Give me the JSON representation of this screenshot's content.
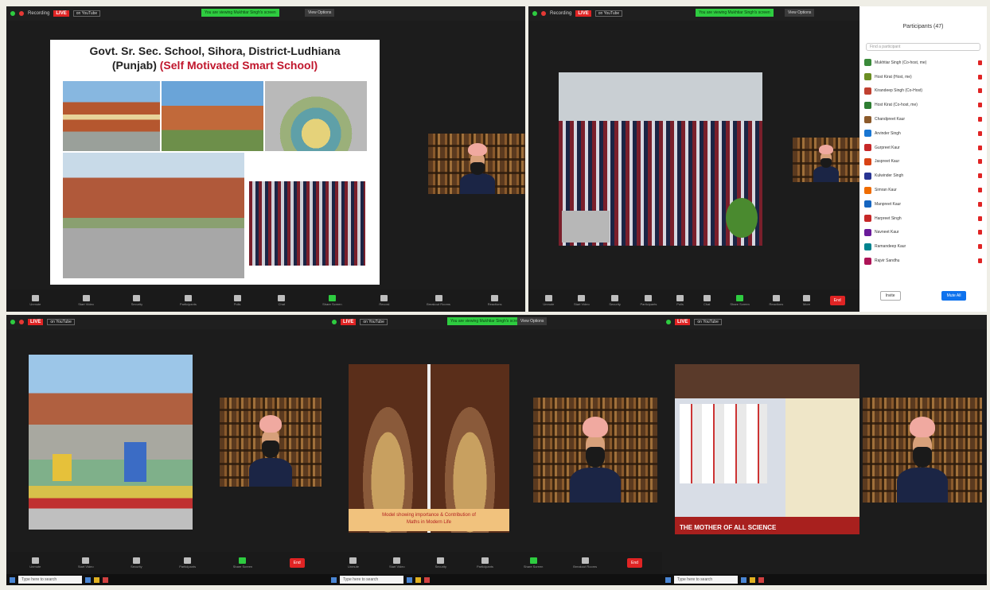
{
  "common": {
    "recording": "Recording",
    "live": "LIVE",
    "youtube": "on YouTube",
    "share_banner": "You are viewing Mukhtiar Singh's screen",
    "view_options": "View Options",
    "end": "End",
    "search_placeholder": "Type here to search"
  },
  "slide": {
    "title_line1": "Govt. Sr. Sec. School, Sihora, District-Ludhiana",
    "title_line2": "(Punjab)",
    "title_sub": "(Self Motivated Smart School)"
  },
  "toolbar": {
    "items": [
      "Unmute",
      "Start Video",
      "Security",
      "Participants",
      "Polls",
      "Chat",
      "Share Screen",
      "Record",
      "Breakout Rooms",
      "Reactions",
      "More"
    ]
  },
  "participants": {
    "title": "Participants (47)",
    "search": "Find a participant",
    "rows": [
      "Mukhtiar Singh (Co-host, me)",
      "Host Kirat (Host, me)",
      "Kirandeep Singh (Co-Host)",
      "Host Kirat (Co-host, me)",
      "Chandpreet Kaur",
      "Arvinder Singh",
      "Gurpreet Kaur",
      "Jaspreet Kaur",
      "Kulwinder Singh",
      "Simran Kaur",
      "Manpreet Kaur",
      "Harpreet Singh",
      "Navneet Kaur",
      "Ramandeep Kaur",
      "Rajvir Sandhu"
    ],
    "invite": "Invite",
    "mute_all": "Mute All"
  },
  "caption": {
    "line1": "Model showing importance & Contribution of",
    "line2": "Maths in Modern Life"
  },
  "sign_label": "THE MOTHER OF ALL SCIENCE"
}
